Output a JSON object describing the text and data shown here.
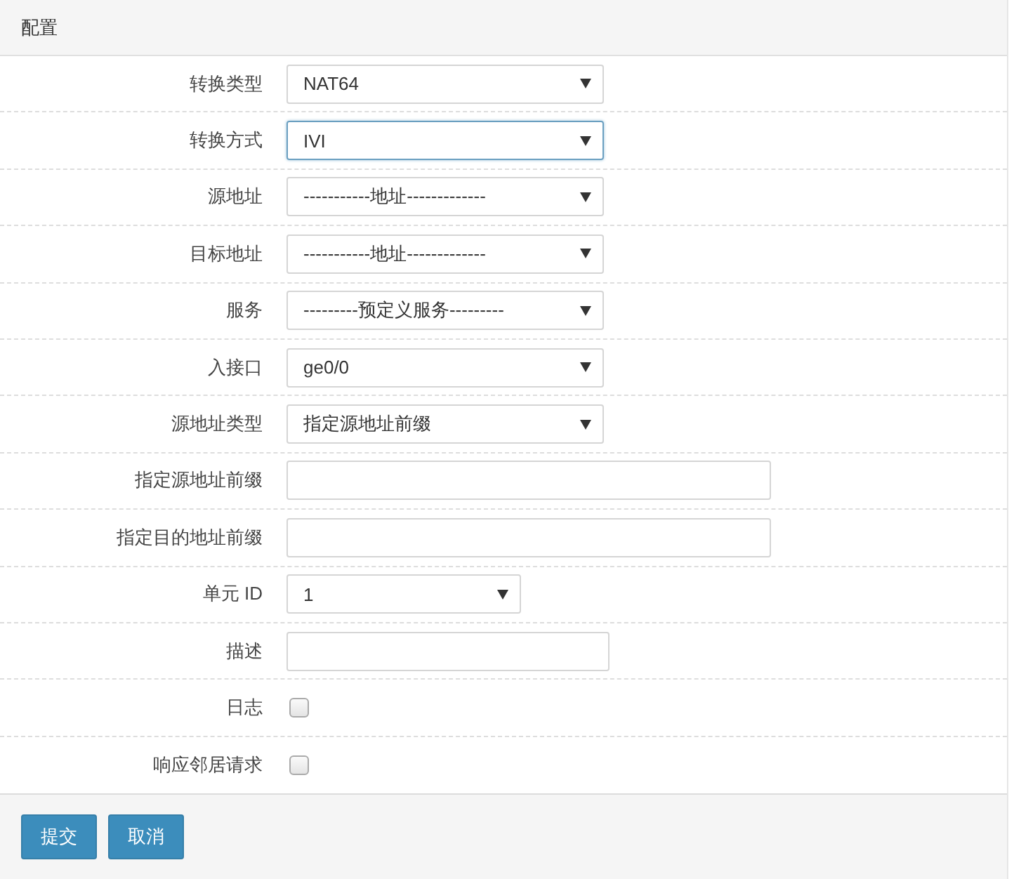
{
  "panel": {
    "title": "配置"
  },
  "fields": [
    {
      "label": "转换类型",
      "kind": "select",
      "value": "NAT64",
      "focused": false
    },
    {
      "label": "转换方式",
      "kind": "select",
      "value": "IVI",
      "focused": true
    },
    {
      "label": "源地址",
      "kind": "select",
      "value": "-----------地址-------------",
      "focused": false
    },
    {
      "label": "目标地址",
      "kind": "select",
      "value": "-----------地址-------------",
      "focused": false
    },
    {
      "label": "服务",
      "kind": "select",
      "value": "---------预定义服务---------",
      "focused": false
    },
    {
      "label": "入接口",
      "kind": "select",
      "value": "ge0/0",
      "focused": false
    },
    {
      "label": "源地址类型",
      "kind": "select",
      "value": "指定源地址前缀",
      "focused": false
    },
    {
      "label": "指定源地址前缀",
      "kind": "text",
      "focused": false
    },
    {
      "label": "指定目的地址前缀",
      "kind": "text",
      "focused": false
    },
    {
      "label": "单元 ID",
      "kind": "select",
      "value": "1",
      "focused": false
    },
    {
      "label": "描述",
      "kind": "text",
      "focused": false
    },
    {
      "label": "日志",
      "kind": "checkbox",
      "checked": false
    },
    {
      "label": "响应邻居请求",
      "kind": "checkbox",
      "checked": false
    }
  ],
  "buttons": [
    "提交",
    "取消"
  ]
}
